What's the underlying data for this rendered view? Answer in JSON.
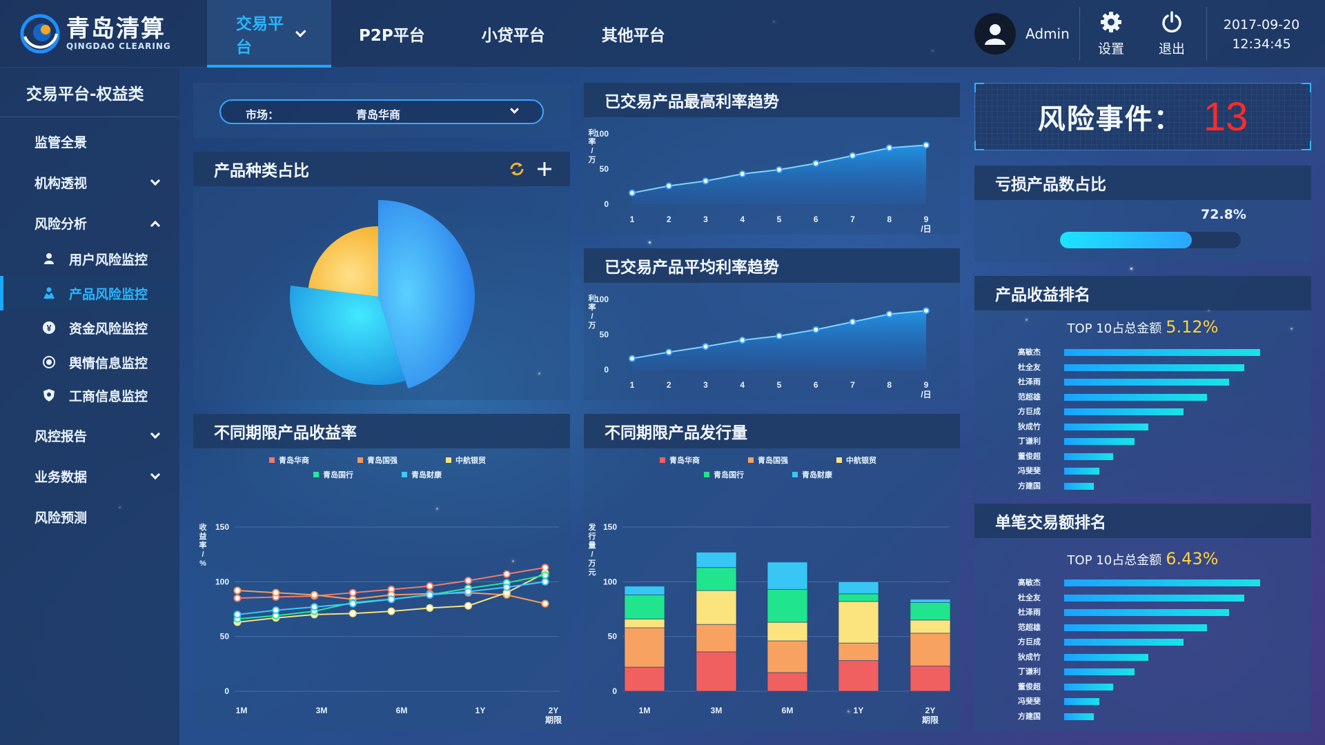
{
  "header": {
    "logo": {
      "cn": "青岛清算",
      "en": "QINGDAO CLEARING"
    },
    "nav": [
      {
        "label": "交易平台",
        "active": true
      },
      {
        "label": "P2P平台"
      },
      {
        "label": "小贷平台"
      },
      {
        "label": "其他平台"
      }
    ],
    "user": "Admin",
    "settings_label": "设置",
    "logout_label": "退出",
    "date": "2017-09-20",
    "time": "12:34:45"
  },
  "sidebar": {
    "title": "交易平台-权益类",
    "items": [
      {
        "label": "监管全景"
      },
      {
        "label": "机构透视"
      },
      {
        "label": "风险分析"
      },
      {
        "label": "用户风险监控"
      },
      {
        "label": "产品风险监控"
      },
      {
        "label": "资金风险监控"
      },
      {
        "label": "舆情信息监控"
      },
      {
        "label": "工商信息监控"
      },
      {
        "label": "风控报告"
      },
      {
        "label": "业务数据"
      },
      {
        "label": "风险预测"
      }
    ]
  },
  "market": {
    "label": "市场：",
    "value": "青岛华商"
  },
  "product_share": {
    "title": "产品种类占比"
  },
  "max_rate": {
    "title": "已交易产品最高利率趋势"
  },
  "avg_rate": {
    "title": "已交易产品平均利率趋势"
  },
  "risk": {
    "label": "风险事件：",
    "count": "13"
  },
  "loss": {
    "title": "亏损产品数占比",
    "value_label": "72.8%",
    "value": 0.728
  },
  "income_rank": {
    "title": "产品收益排名",
    "top_text": "TOP 10占总金额",
    "pct": "5.12%"
  },
  "trade_rank": {
    "title": "单笔交易额排名",
    "top_text": "TOP 10占总金额",
    "pct": "6.43%"
  },
  "yield_chart": {
    "title": "不同期限产品收益率"
  },
  "issue_chart": {
    "title": "不同期限产品发行量"
  },
  "colors": {
    "accent": "#29b6ff",
    "risk": "#ff2a2a",
    "highlight": "#ffd23a"
  },
  "chart_data": [
    {
      "id": "pie",
      "type": "pie",
      "slices": [
        {
          "value": 0.45,
          "color": "#2f86f0"
        },
        {
          "value": 0.32,
          "color": "#27b7f0"
        },
        {
          "value": 0.23,
          "color": "#f8c33c"
        }
      ]
    },
    {
      "id": "max_rate",
      "type": "area",
      "x": [
        1,
        2,
        3,
        4,
        5,
        6,
        7,
        8,
        9
      ],
      "x_ticks": [
        "1",
        "2",
        "3",
        "4",
        "5",
        "6",
        "7",
        "8",
        "9"
      ],
      "values": [
        16,
        26,
        33,
        43,
        49,
        58,
        69,
        80,
        84
      ],
      "ylim": [
        0,
        100
      ],
      "y_ticks": [
        0,
        50,
        100
      ],
      "ylabel": [
        "利",
        "率",
        "/",
        "万"
      ],
      "xunit": "/日"
    },
    {
      "id": "avg_rate",
      "type": "area",
      "x": [
        1,
        2,
        3,
        4,
        5,
        6,
        7,
        8,
        9
      ],
      "x_ticks": [
        "1",
        "2",
        "3",
        "4",
        "5",
        "6",
        "7",
        "8",
        "9"
      ],
      "values": [
        16,
        25,
        33,
        42,
        48,
        57,
        68,
        79,
        84
      ],
      "ylim": [
        0,
        100
      ],
      "y_ticks": [
        0,
        50,
        100
      ],
      "ylabel": [
        "利",
        "率",
        "/",
        "万"
      ],
      "xunit": "/日"
    },
    {
      "id": "yield",
      "type": "line",
      "ticks": [
        "1M",
        "3M",
        "6M",
        "1Y",
        "2Y"
      ],
      "xunit": "期限",
      "ylim": [
        0,
        150
      ],
      "y_ticks": [
        0,
        50,
        100,
        150
      ],
      "ylabel": [
        "收",
        "益",
        "率",
        "/",
        "%"
      ],
      "series": [
        {
          "name": "青岛华商",
          "color": "#f07a6e",
          "values": [
            85,
            86,
            87,
            90,
            93,
            96,
            101,
            107,
            113
          ]
        },
        {
          "name": "青岛国强",
          "color": "#f59a5e",
          "values": [
            92,
            90,
            88,
            84,
            88,
            89,
            90,
            88,
            80
          ]
        },
        {
          "name": "中航银贸",
          "color": "#f5e27a",
          "values": [
            63,
            67,
            70,
            71,
            73,
            76,
            78,
            90,
            108
          ]
        },
        {
          "name": "青岛国行",
          "color": "#23e89a",
          "values": [
            66,
            69,
            73,
            81,
            84,
            88,
            94,
            99,
            106
          ]
        },
        {
          "name": "青岛财康",
          "color": "#3ec6ff",
          "values": [
            70,
            74,
            77,
            80,
            84,
            88,
            91,
            95,
            100
          ]
        }
      ]
    },
    {
      "id": "issue",
      "type": "bar",
      "stacked": true,
      "categories": [
        "1M",
        "3M",
        "6M",
        "1Y",
        "2Y"
      ],
      "xunit": "期限",
      "ylim": [
        0,
        150
      ],
      "y_ticks": [
        0,
        50,
        100,
        150
      ],
      "ylabel": [
        "发",
        "行",
        "量",
        "/",
        "万",
        "元"
      ],
      "series": [
        {
          "name": "青岛华商",
          "color": "#f06060",
          "values": [
            22,
            36,
            17,
            28,
            23
          ]
        },
        {
          "name": "青岛国强",
          "color": "#f8a262",
          "values": [
            36,
            25,
            29,
            16,
            30
          ]
        },
        {
          "name": "中航银贸",
          "color": "#fbe37e",
          "values": [
            8,
            31,
            17,
            38,
            12
          ]
        },
        {
          "name": "青岛国行",
          "color": "#21e58e",
          "values": [
            22,
            21,
            30,
            7,
            16
          ]
        },
        {
          "name": "青岛财康",
          "color": "#38c7f5",
          "values": [
            8,
            14,
            25,
            11,
            3
          ]
        }
      ]
    },
    {
      "id": "income_rank",
      "type": "bar",
      "orientation": "horizontal",
      "categories": [
        "高敏杰",
        "杜全友",
        "杜泽雨",
        "范超雄",
        "方巨成",
        "狄成竹",
        "丁谦利",
        "董俊超",
        "冯斐斐",
        "方建国"
      ],
      "values": [
        100,
        92,
        84,
        73,
        61,
        43,
        36,
        25,
        18,
        15
      ]
    },
    {
      "id": "trade_rank",
      "type": "bar",
      "orientation": "horizontal",
      "categories": [
        "高敏杰",
        "杜全友",
        "杜泽雨",
        "范超雄",
        "方巨成",
        "狄成竹",
        "丁谦利",
        "董俊超",
        "冯斐斐",
        "方建国"
      ],
      "values": [
        100,
        92,
        84,
        73,
        61,
        43,
        36,
        25,
        18,
        15
      ]
    }
  ]
}
